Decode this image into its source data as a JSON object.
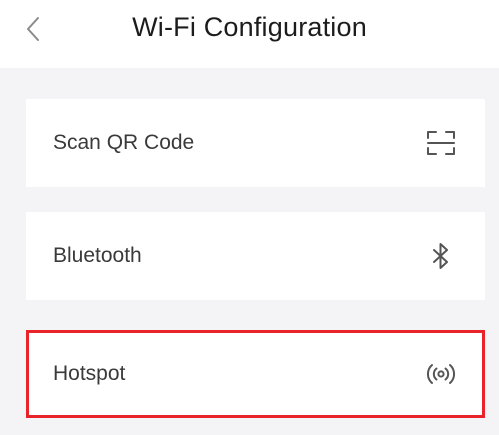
{
  "header": {
    "title": "Wi-Fi Configuration",
    "back_icon": "chevron-left-icon"
  },
  "options": [
    {
      "label": "Scan QR Code",
      "icon": "scan-qr-icon",
      "highlighted": false
    },
    {
      "label": "Bluetooth",
      "icon": "bluetooth-icon",
      "highlighted": false
    },
    {
      "label": "Hotspot",
      "icon": "hotspot-icon",
      "highlighted": true
    }
  ],
  "colors": {
    "highlight": "#e8242a",
    "background": "#f4f4f6"
  }
}
